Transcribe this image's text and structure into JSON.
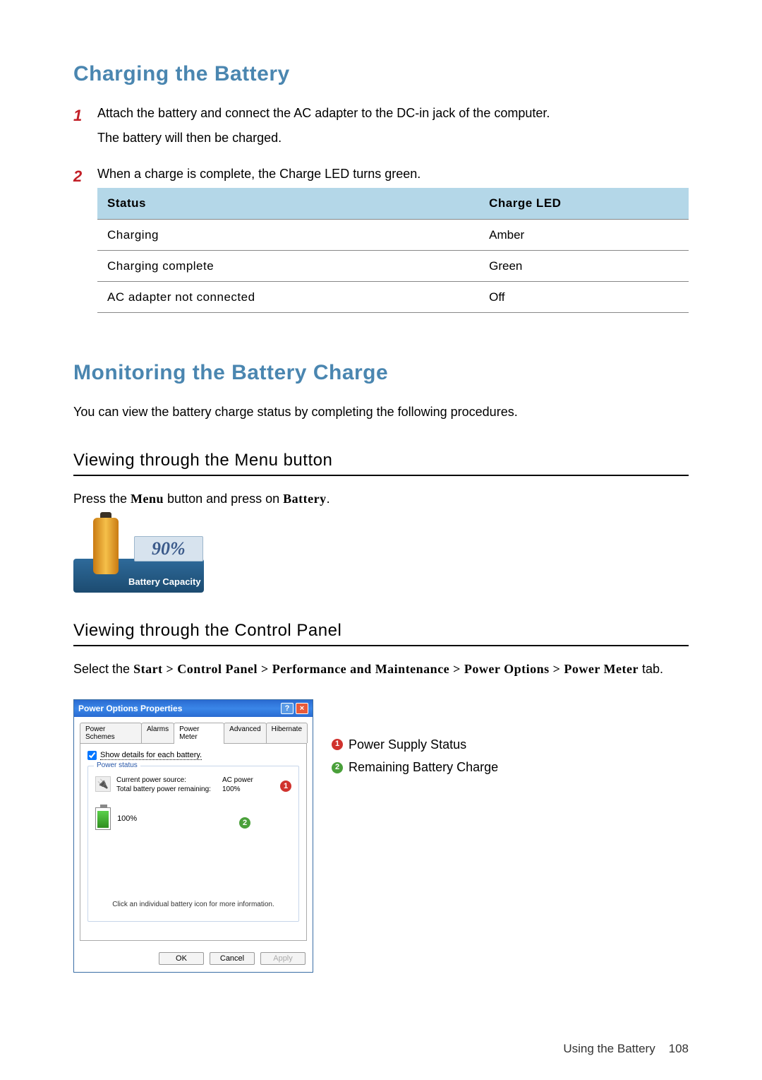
{
  "headings": {
    "charging": "Charging the Battery",
    "monitoring": "Monitoring the Battery Charge",
    "menu_button": "Viewing through the Menu button",
    "control_panel": "Viewing through the Control Panel"
  },
  "steps_charging": [
    {
      "num": "1",
      "lines": [
        "Attach the battery and connect the AC adapter to the DC-in jack of the computer.",
        "The battery will then be charged."
      ]
    },
    {
      "num": "2",
      "lines": [
        "When a charge is complete, the Charge LED turns green."
      ]
    }
  ],
  "led_table": {
    "headers": [
      "Status",
      "Charge LED"
    ],
    "rows": [
      [
        "Charging",
        "Amber"
      ],
      [
        "Charging complete",
        "Green"
      ],
      [
        "AC adapter not connected",
        "Off"
      ]
    ]
  },
  "monitoring_intro": "You can view the battery charge status by completing the following procedures.",
  "menu_button_text_pre": "Press the ",
  "menu_button_text_menu": "Menu",
  "menu_button_text_mid": " button and press on ",
  "menu_button_text_batt": "Battery",
  "menu_button_text_end": ".",
  "battery_widget": {
    "percent": "90%",
    "label": "Battery Capacity"
  },
  "control_panel_text": {
    "pre": "Select the ",
    "path": "Start > Control Panel > Performance and Maintenance > Power Options > Power Meter",
    "post": " tab."
  },
  "dialog": {
    "title": "Power Options Properties",
    "help": "?",
    "close": "×",
    "tabs": [
      "Power Schemes",
      "Alarms",
      "Power Meter",
      "Advanced",
      "Hibernate"
    ],
    "active_tab_index": 2,
    "checkbox_label": "Show details for each battery.",
    "fieldset_legend": "Power status",
    "rows": [
      {
        "label": "Current power source:",
        "value": "AC power"
      },
      {
        "label": "Total battery power remaining:",
        "value": "100%"
      }
    ],
    "battery_percent": "100%",
    "hint": "Click an individual battery icon for more information.",
    "buttons": {
      "ok": "OK",
      "cancel": "Cancel",
      "apply": "Apply"
    }
  },
  "callouts": [
    {
      "num": "1",
      "label": "Power Supply Status",
      "class": "co-red"
    },
    {
      "num": "2",
      "label": "Remaining Battery Charge",
      "class": "co-green"
    }
  ],
  "footer": {
    "section": "Using the Battery",
    "page": "108"
  }
}
